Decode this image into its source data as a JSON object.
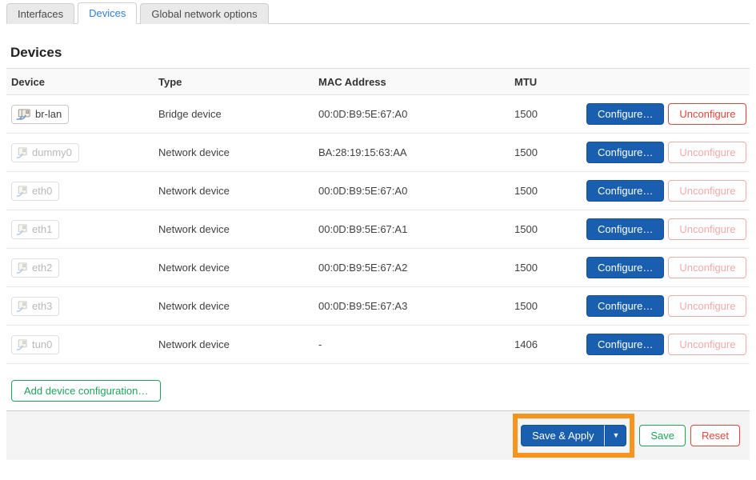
{
  "tabs": [
    {
      "label": "Interfaces",
      "active": false
    },
    {
      "label": "Devices",
      "active": true
    },
    {
      "label": "Global network options",
      "active": false
    }
  ],
  "page": {
    "title": "Devices"
  },
  "table": {
    "columns": [
      "Device",
      "Type",
      "MAC Address",
      "MTU",
      ""
    ],
    "configure_label": "Configure…",
    "unconfigure_label": "Unconfigure",
    "rows": [
      {
        "device": "br-lan",
        "icon": "bridge-icon",
        "type": "Bridge device",
        "mac": "00:0D:B9:5E:67:A0",
        "mtu": "1500",
        "up": true,
        "unconfigure_enabled": true
      },
      {
        "device": "dummy0",
        "icon": "ethernet-icon",
        "type": "Network device",
        "mac": "BA:28:19:15:63:AA",
        "mtu": "1500",
        "up": false,
        "unconfigure_enabled": false
      },
      {
        "device": "eth0",
        "icon": "ethernet-icon",
        "type": "Network device",
        "mac": "00:0D:B9:5E:67:A0",
        "mtu": "1500",
        "up": false,
        "unconfigure_enabled": false
      },
      {
        "device": "eth1",
        "icon": "ethernet-icon",
        "type": "Network device",
        "mac": "00:0D:B9:5E:67:A1",
        "mtu": "1500",
        "up": false,
        "unconfigure_enabled": false
      },
      {
        "device": "eth2",
        "icon": "ethernet-icon",
        "type": "Network device",
        "mac": "00:0D:B9:5E:67:A2",
        "mtu": "1500",
        "up": false,
        "unconfigure_enabled": false
      },
      {
        "device": "eth3",
        "icon": "ethernet-icon",
        "type": "Network device",
        "mac": "00:0D:B9:5E:67:A3",
        "mtu": "1500",
        "up": false,
        "unconfigure_enabled": false
      },
      {
        "device": "tun0",
        "icon": "ethernet-icon",
        "type": "Network device",
        "mac": "-",
        "mtu": "1406",
        "up": false,
        "unconfigure_enabled": false
      }
    ]
  },
  "actions": {
    "add_label": "Add device configuration…"
  },
  "footer": {
    "save_apply_label": "Save & Apply",
    "dropdown_icon": "▼",
    "save_label": "Save",
    "reset_label": "Reset"
  },
  "colors": {
    "primary_button": "#1a5eb0",
    "link_blue": "#2f7cd6",
    "danger_red": "#e2453c",
    "positive_green": "#1fa35c",
    "annotation_orange": "#f7941d",
    "footer_bg": "#f4f4f4",
    "header_bg": "#f9f9f9"
  }
}
